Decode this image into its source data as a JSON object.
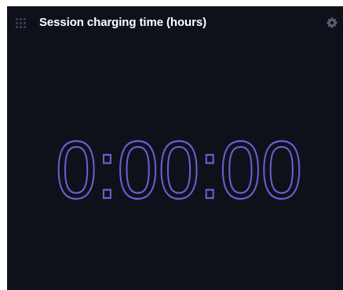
{
  "widget": {
    "title": "Session charging time (hours)",
    "timer_value": "0:00:00",
    "accent_color": "#6b5fd6",
    "background_color": "#0e111a",
    "icons": {
      "drag": "drag-handle-icon",
      "settings": "gear-icon"
    }
  }
}
